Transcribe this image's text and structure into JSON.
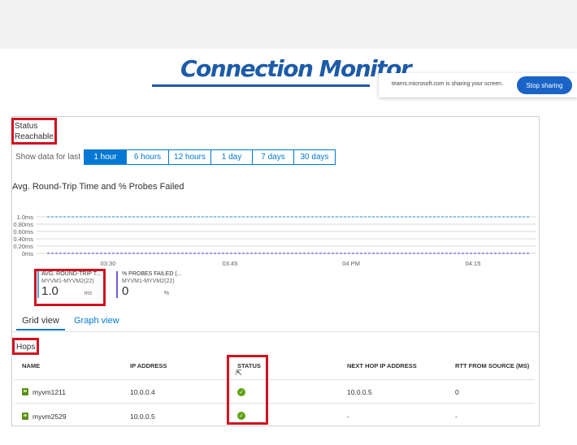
{
  "title": "Connection Monitor",
  "share_bar": {
    "message": "teams.microsoft.com is sharing your screen.",
    "stop_label": "Stop sharing"
  },
  "status": {
    "label": "Status",
    "value": "Reachable"
  },
  "time_filter": {
    "label": "Show data for last",
    "options": [
      "1 hour",
      "6 hours",
      "12 hours",
      "1 day",
      "7 days",
      "30 days"
    ],
    "selected": "1 hour"
  },
  "chart_title": "Avg. Round-Trip Time and % Probes Failed",
  "chart_data": {
    "type": "line",
    "title": "Avg. Round-Trip Time and % Probes Failed",
    "y_ticks": [
      "1.0ms",
      "0.80ms",
      "0.60ms",
      "0.40ms",
      "0.20ms",
      "0ms"
    ],
    "ylim": [
      0,
      1.0
    ],
    "x_ticks": [
      "03:30",
      "03:45",
      "04 PM",
      "04:15"
    ],
    "grid": true,
    "series": [
      {
        "name": "AVG. ROUND-TRIP T...",
        "color": "#4aa3df",
        "values": [
          1.0,
          1.0,
          1.0,
          1.0,
          1.0
        ]
      },
      {
        "name": "% PROBES FAILED (...",
        "color": "#6b5bd6",
        "values": [
          0,
          0,
          0,
          0,
          0
        ]
      }
    ]
  },
  "legend": [
    {
      "title": "AVG. ROUND-TRIP T...",
      "subtitle": "MYVM1-MYVM2(22)",
      "value": "1.0",
      "unit": "ms",
      "color": "#4aa3df"
    },
    {
      "title": "% PROBES FAILED (...",
      "subtitle": "MYVM1-MYVM2(22)",
      "value": "0",
      "unit": "%",
      "color": "#6b5bd6"
    }
  ],
  "tabs": {
    "grid": "Grid view",
    "graph": "Graph view"
  },
  "hops_label": "Hops",
  "table": {
    "headers": [
      "NAME",
      "IP ADDRESS",
      "STATUS",
      "NEXT HOP IP ADDRESS",
      "RTT FROM SOURCE (MS)"
    ],
    "rows": [
      {
        "name": "myvm1211",
        "ip": "10.0.0.4",
        "next_hop": "10.0.0.5",
        "rtt": "0"
      },
      {
        "name": "myvm2529",
        "ip": "10.0.0.5",
        "next_hop": "-",
        "rtt": "-"
      }
    ]
  },
  "colors": {
    "accent": "#0078d4",
    "highlight_box": "#d1111f",
    "status_ok": "#5ea117"
  }
}
